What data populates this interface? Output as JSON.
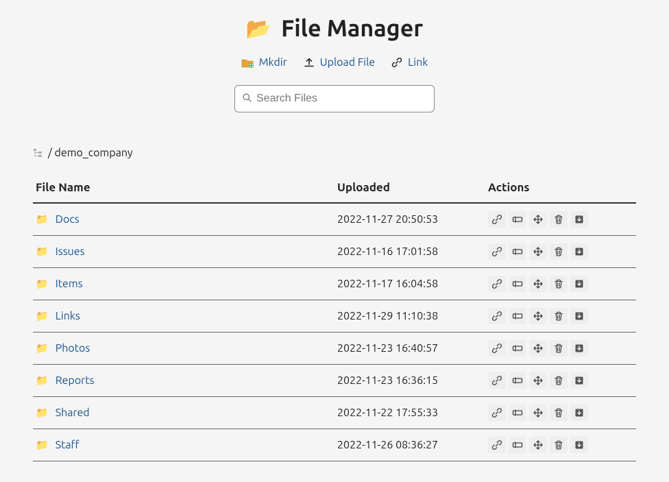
{
  "header": {
    "title": "File Manager"
  },
  "toolbar": {
    "mkdir": "Mkdir",
    "upload": "Upload File",
    "link": "Link"
  },
  "search": {
    "placeholder": "Search Files"
  },
  "breadcrumb": {
    "path": "/ demo_company"
  },
  "table": {
    "headers": {
      "name": "File Name",
      "uploaded": "Uploaded",
      "actions": "Actions"
    },
    "rows": [
      {
        "name": "Docs",
        "uploaded": "2022-11-27 20:50:53"
      },
      {
        "name": "Issues",
        "uploaded": "2022-11-16 17:01:58"
      },
      {
        "name": "Items",
        "uploaded": "2022-11-17 16:04:58"
      },
      {
        "name": "Links",
        "uploaded": "2022-11-29 11:10:38"
      },
      {
        "name": "Photos",
        "uploaded": "2022-11-23 16:40:57"
      },
      {
        "name": "Reports",
        "uploaded": "2022-11-23 16:36:15"
      },
      {
        "name": "Shared",
        "uploaded": "2022-11-22 17:55:33"
      },
      {
        "name": "Staff",
        "uploaded": "2022-11-26 08:36:27"
      }
    ]
  }
}
